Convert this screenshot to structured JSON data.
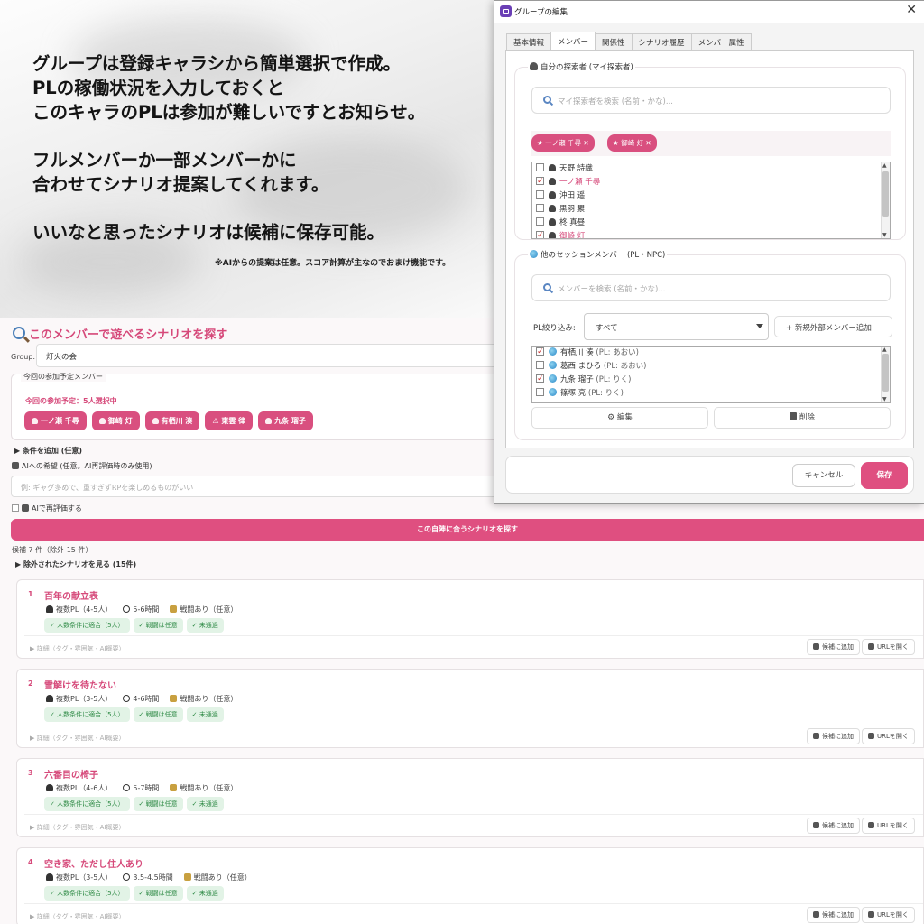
{
  "promo": {
    "lines": [
      "グループは登録キャラシから簡単選択で作成。",
      "PLの稼働状況を入力しておくと",
      "このキャラのPLは参加が難しいですとお知らせ。",
      "フルメンバーか一部メンバーかに",
      "合わせてシナリオ提案してくれます。",
      "いいなと思ったシナリオは候補に保存可能。"
    ],
    "note": "※AIからの提案は任意。スコア計算が主なのでおまけ機能です。"
  },
  "app": {
    "title": "このメンバーで遊べるシナリオを探す",
    "group_label": "Group:",
    "group_value": "灯火の会",
    "members_legend": "今回の参加予定メンバー",
    "members_count": "今回の参加予定：5人選択中",
    "member_chips": [
      "一ノ瀬 千尋",
      "御崎 灯",
      "有栖川 湊",
      "⚠ 東雲 律",
      "九条 瑠子"
    ],
    "add_condition": "▶ 条件を追加 (任意)",
    "ai_hope_label": "AIへの希望 (任意。AI再評価時のみ使用)",
    "ai_hope_placeholder": "例: ギャグ多めで、重すぎずRPを楽しめるものがいい",
    "ai_reeval_label": "AIで再評価する",
    "search_button": "この自陣に合うシナリオを探す",
    "candidate_count": "候補 7 件（除外 15 件）",
    "excluded_toggle": "▶ 除外されたシナリオを見る (15件)",
    "detail_label": "▶ 詳細（タグ・雰囲気・AI概要）",
    "add_candidate": "候補に追加",
    "open_url": "URLを開く",
    "cards": [
      {
        "num": "1",
        "title": "百年の献立表",
        "players": "複数PL（4-5人）",
        "time": "5-6時間",
        "combat": "戦闘あり（任意）",
        "tags": [
          "✓ 人数条件に適合（5人）",
          "✓ 戦闘は任意",
          "✓ 未通過"
        ]
      },
      {
        "num": "2",
        "title": "雪解けを待たない",
        "players": "複数PL（3-5人）",
        "time": "4-6時間",
        "combat": "戦闘あり（任意）",
        "tags": [
          "✓ 人数条件に適合（5人）",
          "✓ 戦闘は任意",
          "✓ 未通過"
        ]
      },
      {
        "num": "3",
        "title": "六番目の椅子",
        "players": "複数PL（4-6人）",
        "time": "5-7時間",
        "combat": "戦闘あり（任意）",
        "tags": [
          "✓ 人数条件に適合（5人）",
          "✓ 戦闘は任意",
          "✓ 未通過"
        ]
      },
      {
        "num": "4",
        "title": "空き家、ただし住人あり",
        "players": "複数PL（3-5人）",
        "time": "3.5-4.5時間",
        "combat": "戦闘あり（任意）",
        "tags": [
          "✓ 人数条件に適合（5人）",
          "✓ 戦闘は任意",
          "✓ 未通過"
        ]
      }
    ]
  },
  "dialog": {
    "title": "グループの編集",
    "close": "✕",
    "tabs": [
      "基本情報",
      "メンバー",
      "関係性",
      "シナリオ履歴",
      "メンバー属性"
    ],
    "my_group_label": "自分の探索者 (マイ探索者)",
    "my_search_placeholder": "マイ探索者を検索 (名前・かな)...",
    "my_chips": [
      "★ 一ノ瀬 千尋 ✕",
      "★ 御崎 灯 ✕"
    ],
    "my_list": [
      {
        "name": "天野 詩織",
        "checked": false
      },
      {
        "name": "一ノ瀬 千尋",
        "checked": true
      },
      {
        "name": "沖田 遥",
        "checked": false
      },
      {
        "name": "黒羽 累",
        "checked": false
      },
      {
        "name": "柊 真昼",
        "checked": false
      },
      {
        "name": "御崎 灯",
        "checked": true
      }
    ],
    "other_group_label": "他のセッションメンバー (PL・NPC)",
    "member_search_placeholder": "メンバーを検索 (名前・かな)...",
    "filter_label": "PL絞り込み:",
    "filter_value": "すべて",
    "add_external": "+ 新規外部メンバー追加",
    "other_list": [
      {
        "name": "有栖川 湊",
        "pl": "(PL: あおい)",
        "checked": true
      },
      {
        "name": "葛西 まひろ",
        "pl": "(PL: あおい)",
        "checked": false
      },
      {
        "name": "九条 瑠子",
        "pl": "(PL: りく)",
        "checked": true
      },
      {
        "name": "篠塚 亮",
        "pl": "(PL: りく)",
        "checked": false
      },
      {
        "name": "東雲 律",
        "pl": "(PL: ひな)",
        "checked": true
      }
    ],
    "edit_button": "編集",
    "delete_button": "削除",
    "cancel_button": "キャンセル",
    "save_button": "保存"
  }
}
